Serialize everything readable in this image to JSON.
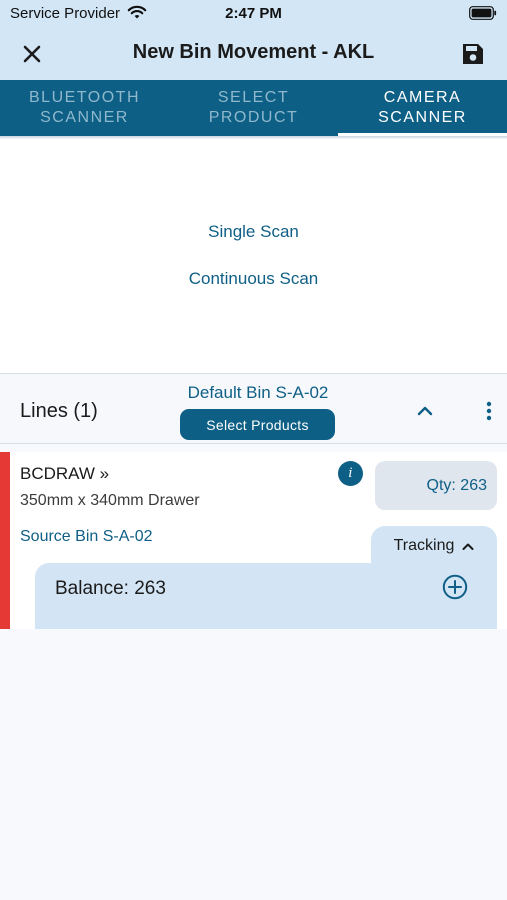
{
  "status_bar": {
    "carrier": "Service Provider",
    "time": "2:47 PM"
  },
  "app_bar": {
    "title": "New Bin Movement - AKL",
    "close_icon": "close-icon",
    "save_icon": "save-icon"
  },
  "tabs": [
    {
      "label": "BLUETOOTH\nSCANNER",
      "active": false
    },
    {
      "label": "SELECT\nPRODUCT",
      "active": false
    },
    {
      "label": "CAMERA\nSCANNER",
      "active": true
    }
  ],
  "scan_options": {
    "single": "Single Scan",
    "continuous": "Continuous Scan"
  },
  "lines": {
    "title": "Lines (1)",
    "default_bin": "Default Bin S-A-02",
    "select_products_label": "Select Products"
  },
  "line_items": [
    {
      "code": "BCDRAW »",
      "description": "350mm x 340mm Drawer",
      "qty": "Qty: 263",
      "source_bin": "Source Bin S-A-02",
      "tracking_label": "Tracking",
      "balance": "Balance: 263",
      "status_color": "#e53935"
    }
  ],
  "colors": {
    "primary": "#0d5f86",
    "app_bar_bg": "#d2e6f6",
    "error": "#e53935"
  }
}
